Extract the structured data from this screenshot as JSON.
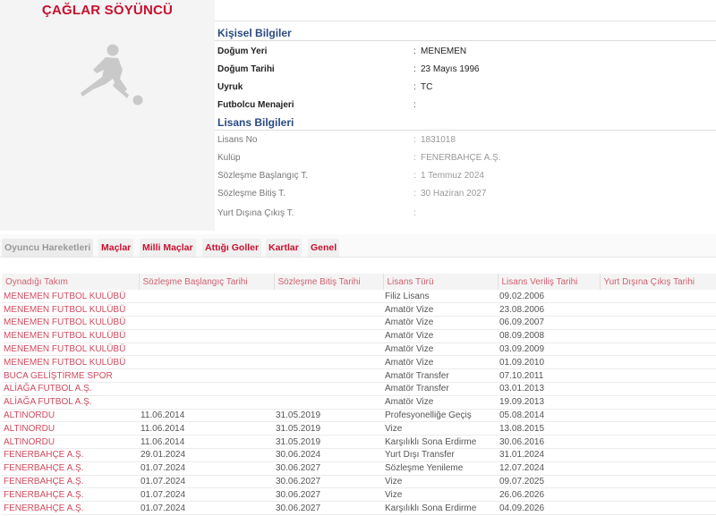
{
  "player": {
    "name": "ÇAĞLAR SÖYÜNCÜ"
  },
  "personal": {
    "title": "Kişisel Bilgiler",
    "rows": [
      {
        "label": "Doğum Yeri",
        "value": "MENEMEN"
      },
      {
        "label": "Doğum Tarihi",
        "value": "23 Mayıs 1996"
      },
      {
        "label": "Uyruk",
        "value": "TC"
      },
      {
        "label": "Futbolcu Menajeri",
        "value": ""
      }
    ]
  },
  "license": {
    "title": "Lisans Bilgileri",
    "rows": [
      {
        "label": "Lisans No",
        "value": "1831018"
      },
      {
        "label": "Kulüp",
        "value": "FENERBAHÇE A.Ş."
      },
      {
        "label": "Sözleşme Başlangıç T.",
        "value": "1 Temmuz 2024"
      },
      {
        "label": "Sözleşme Bitiş T.",
        "value": "30 Haziran 2027"
      },
      {
        "label": "Yurt Dışına Çıkış T.",
        "value": ""
      }
    ]
  },
  "colon": ":",
  "tabs": [
    {
      "label": "Oyuncu Hareketleri",
      "active": true
    },
    {
      "label": "Maçlar"
    },
    {
      "label": "Milli Maçlar"
    },
    {
      "label": "Attığı Goller"
    },
    {
      "label": "Kartlar"
    },
    {
      "label": "Genel"
    }
  ],
  "table": {
    "headers": [
      "Oynadığı Takım",
      "Sözleşme Başlangıç Tarihi",
      "Sözleşme Bitiş Tarihi",
      "Lisans Türü",
      "Lisans Veriliş Tarihi",
      "Yurt Dışına Çıkış Tarihi"
    ],
    "rows": [
      [
        "MENEMEN FUTBOL KULÜBÜ",
        "",
        "",
        "Filiz Lisans",
        "09.02.2006",
        ""
      ],
      [
        "MENEMEN FUTBOL KULÜBÜ",
        "",
        "",
        "Amatör Vize",
        "23.08.2006",
        ""
      ],
      [
        "MENEMEN FUTBOL KULÜBÜ",
        "",
        "",
        "Amatör Vize",
        "06.09.2007",
        ""
      ],
      [
        "MENEMEN FUTBOL KULÜBÜ",
        "",
        "",
        "Amatör Vize",
        "08.09.2008",
        ""
      ],
      [
        "MENEMEN FUTBOL KULÜBÜ",
        "",
        "",
        "Amatör Vize",
        "03.09.2009",
        ""
      ],
      [
        "MENEMEN FUTBOL KULÜBÜ",
        "",
        "",
        "Amatör Vize",
        "01.09.2010",
        ""
      ],
      [
        "BUCA GELİŞTİRME SPOR",
        "",
        "",
        "Amatör Transfer",
        "07.10.2011",
        ""
      ],
      [
        "ALİAĞA FUTBOL A.Ş.",
        "",
        "",
        "Amatör Transfer",
        "03.01.2013",
        ""
      ],
      [
        "ALİAĞA FUTBOL A.Ş.",
        "",
        "",
        "Amatör Vize",
        "19.09.2013",
        ""
      ],
      [
        "ALTINORDU",
        "11.06.2014",
        "31.05.2019",
        "Profesyonelliğe Geçiş",
        "05.08.2014",
        ""
      ],
      [
        "ALTINORDU",
        "11.06.2014",
        "31.05.2019",
        "Vize",
        "13.08.2015",
        ""
      ],
      [
        "ALTINORDU",
        "11.06.2014",
        "31.05.2019",
        "Karşılıklı Sona Erdirme",
        "30.06.2016",
        ""
      ],
      [
        "FENERBAHÇE A.Ş.",
        "29.01.2024",
        "30.06.2024",
        "Yurt Dışı Transfer",
        "31.01.2024",
        ""
      ],
      [
        "FENERBAHÇE A.Ş.",
        "01.07.2024",
        "30.06.2027",
        "Sözleşme Yenileme",
        "12.07.2024",
        ""
      ],
      [
        "FENERBAHÇE A.Ş.",
        "01.07.2024",
        "30.06.2027",
        "Vize",
        "09.07.2025",
        ""
      ],
      [
        "FENERBAHÇE A.Ş.",
        "01.07.2024",
        "30.06.2027",
        "Vize",
        "26.06.2026",
        ""
      ],
      [
        "FENERBAHÇE A.Ş.",
        "01.07.2024",
        "30.06.2027",
        "Karşılıklı Sona Erdirme",
        "04.09.2026",
        ""
      ]
    ]
  },
  "colors": {
    "brand_red": "#c8102e",
    "section_blue": "#2a4a82"
  }
}
